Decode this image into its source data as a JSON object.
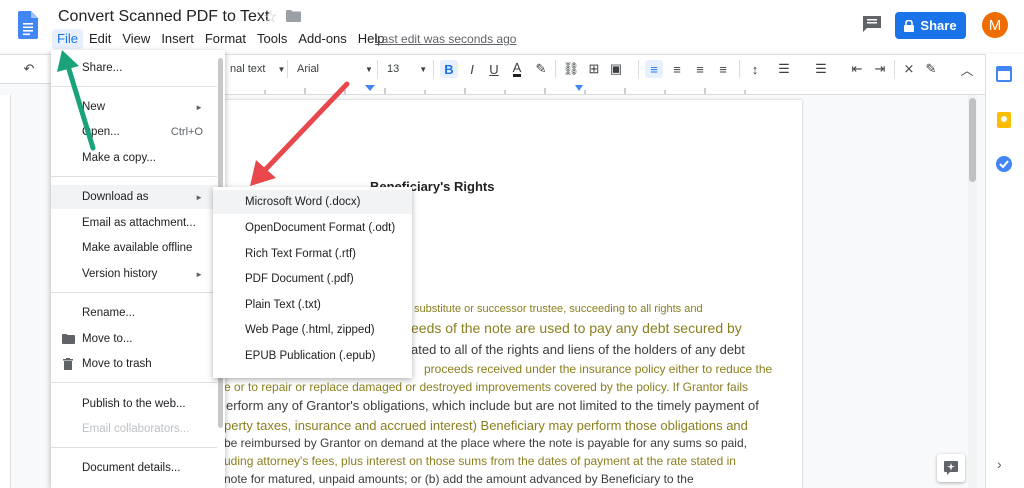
{
  "header": {
    "title": "Convert Scanned PDF to Text",
    "last_edit": "Last edit was seconds ago",
    "share_label": "Share",
    "avatar_letter": "M"
  },
  "menubar": [
    "File",
    "Edit",
    "View",
    "Insert",
    "Format",
    "Tools",
    "Add-ons",
    "Help"
  ],
  "toolbar": {
    "style_value": "nal text",
    "font_value": "Arial",
    "size_value": "13"
  },
  "file_menu": {
    "share": "Share...",
    "new": "New",
    "open": "Open...",
    "open_shortcut": "Ctrl+O",
    "make_copy": "Make a copy...",
    "download_as": "Download as",
    "email_attachment": "Email as attachment...",
    "make_offline": "Make available offline",
    "version_history": "Version history",
    "rename": "Rename...",
    "move_to": "Move to...",
    "move_trash": "Move to trash",
    "publish": "Publish to the web...",
    "email_collab": "Email collaborators...",
    "doc_details": "Document details..."
  },
  "download_submenu": [
    "Microsoft Word (.docx)",
    "OpenDocument Format (.odt)",
    "Rich Text Format (.rtf)",
    "PDF Document (.pdf)",
    "Plain Text (.txt)",
    "Web Page (.html, zipped)",
    "EPUB Publication (.epub)"
  ],
  "document": {
    "heading": "Beneficiary's Rights",
    "lines": [
      "substitute or successor trustee, succeeding to all rights and",
      "eeds of the note are used to pay any debt secured by",
      "ated to all of the rights and liens of the holders of any debt",
      "proceeds received under the insurance policy either to reduce the",
      "e or to repair or replace damaged or destroyed improvements covered by the policy. If Grantor fails",
      "erform any of Grantor's obligations, which include but are not limited to the timely payment of",
      "perty taxes, insurance and accrued interest) Beneficiary may perform those obligations and",
      "be reimbursed by Grantor on demand at the place where the note is payable for any sums so paid,",
      "uding attorney's fees, plus interest on those sums from the dates of payment at the rate stated in",
      "note for matured, unpaid amounts; or (b) add the amount advanced by Beneficiary to the"
    ]
  },
  "colors": {
    "accent": "#1a73e8",
    "green_arrow": "#1aa37a",
    "red_arrow": "#e8474c",
    "avatar": "#ef6c00"
  }
}
